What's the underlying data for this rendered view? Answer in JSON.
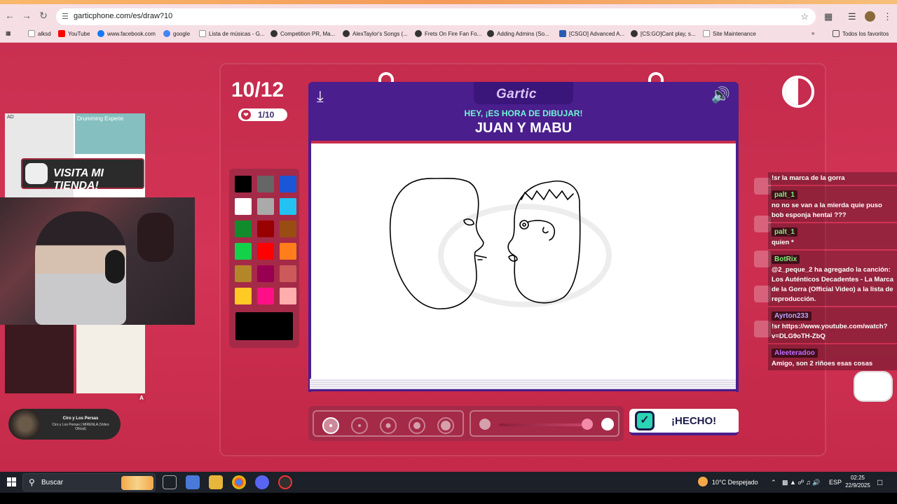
{
  "browser": {
    "url": "garticphone.com/es/draw?10",
    "bookmarks": [
      {
        "label": "alksd",
        "color": "#ffffff"
      },
      {
        "label": "YouTube",
        "color": "#ff0000"
      },
      {
        "label": "www.facebook.com",
        "color": "#1877f2"
      },
      {
        "label": "google",
        "color": "#4285f4"
      },
      {
        "label": "Lista de músicas - G...",
        "color": "#ffffff"
      },
      {
        "label": "Competition PR, Ma...",
        "color": "#333333"
      },
      {
        "label": "AlexTaylor's Songs (...",
        "color": "#333333"
      },
      {
        "label": "Frets On Fire Fan Fo...",
        "color": "#333333"
      },
      {
        "label": "Adding Admins (So...",
        "color": "#333333"
      },
      {
        "label": "[CSGO] Advanced A...",
        "color": "#2a5db0"
      },
      {
        "label": "[CS:GO]Cant play, s...",
        "color": "#333333"
      },
      {
        "label": "Site Maintenance",
        "color": "#ffffff"
      }
    ],
    "all_favorites": "Todos los favoritos"
  },
  "game": {
    "round": "10/12",
    "likes": "1/10",
    "logo": "Gartic",
    "prompt_header": "HEY, ¡ES HORA DE DIBUJAR!",
    "prompt_word": "JUAN Y MABU",
    "done_label": "¡HECHO!",
    "palette": [
      "#000000",
      "#666666",
      "#1a56d6",
      "#ffffff",
      "#aaaaaa",
      "#23c2f2",
      "#118c2c",
      "#990000",
      "#994d12",
      "#14d14a",
      "#ff0000",
      "#ff7d1a",
      "#b3862a",
      "#990052",
      "#cc5a5a",
      "#ffc926",
      "#ff0f85",
      "#ffadad"
    ],
    "selected_color": "#000000",
    "watermark": "Gartic PHONE"
  },
  "overlay": {
    "ad_label": "AD",
    "ad_promo": "Drumming Experie",
    "store_text": "VISITA MI TIENDA!",
    "shop_badge": "A",
    "song_title": "Ciro y Los Persas",
    "song_subtitle": "Ciro y Los Persas | MIRENLA (Video Oficial)"
  },
  "chat": [
    {
      "user": "",
      "user_color": "",
      "text": "!sr la marca de la gorra"
    },
    {
      "user": "palt_1",
      "user_color": "#7af07a",
      "text": "no no se van a la mierda quie puso bob esponja hentai ???"
    },
    {
      "user": "palt_1",
      "user_color": "#7af07a",
      "text": "quien *"
    },
    {
      "user": "BotRix",
      "user_color": "#7af07a",
      "text": "@2_peque_2 ha agregado la canción: Los Auténticos Decadentes - La Marca de la Gorra (Official Video) a la lista de reproducción."
    },
    {
      "user": "Ayrton233",
      "user_color": "#b7a7ff",
      "text": "!sr https://www.youtube.com/watch?v=DLG9oTH-ZbQ"
    },
    {
      "user": "Aleeteradoo",
      "user_color": "#c06bff",
      "text": "Amigo, son 2 riñoes esas cosas"
    }
  ],
  "taskbar": {
    "search": "Buscar",
    "weather": "10°C  Despejado",
    "lang": "ESP",
    "time": "02:25",
    "date": "22/9/2025"
  }
}
